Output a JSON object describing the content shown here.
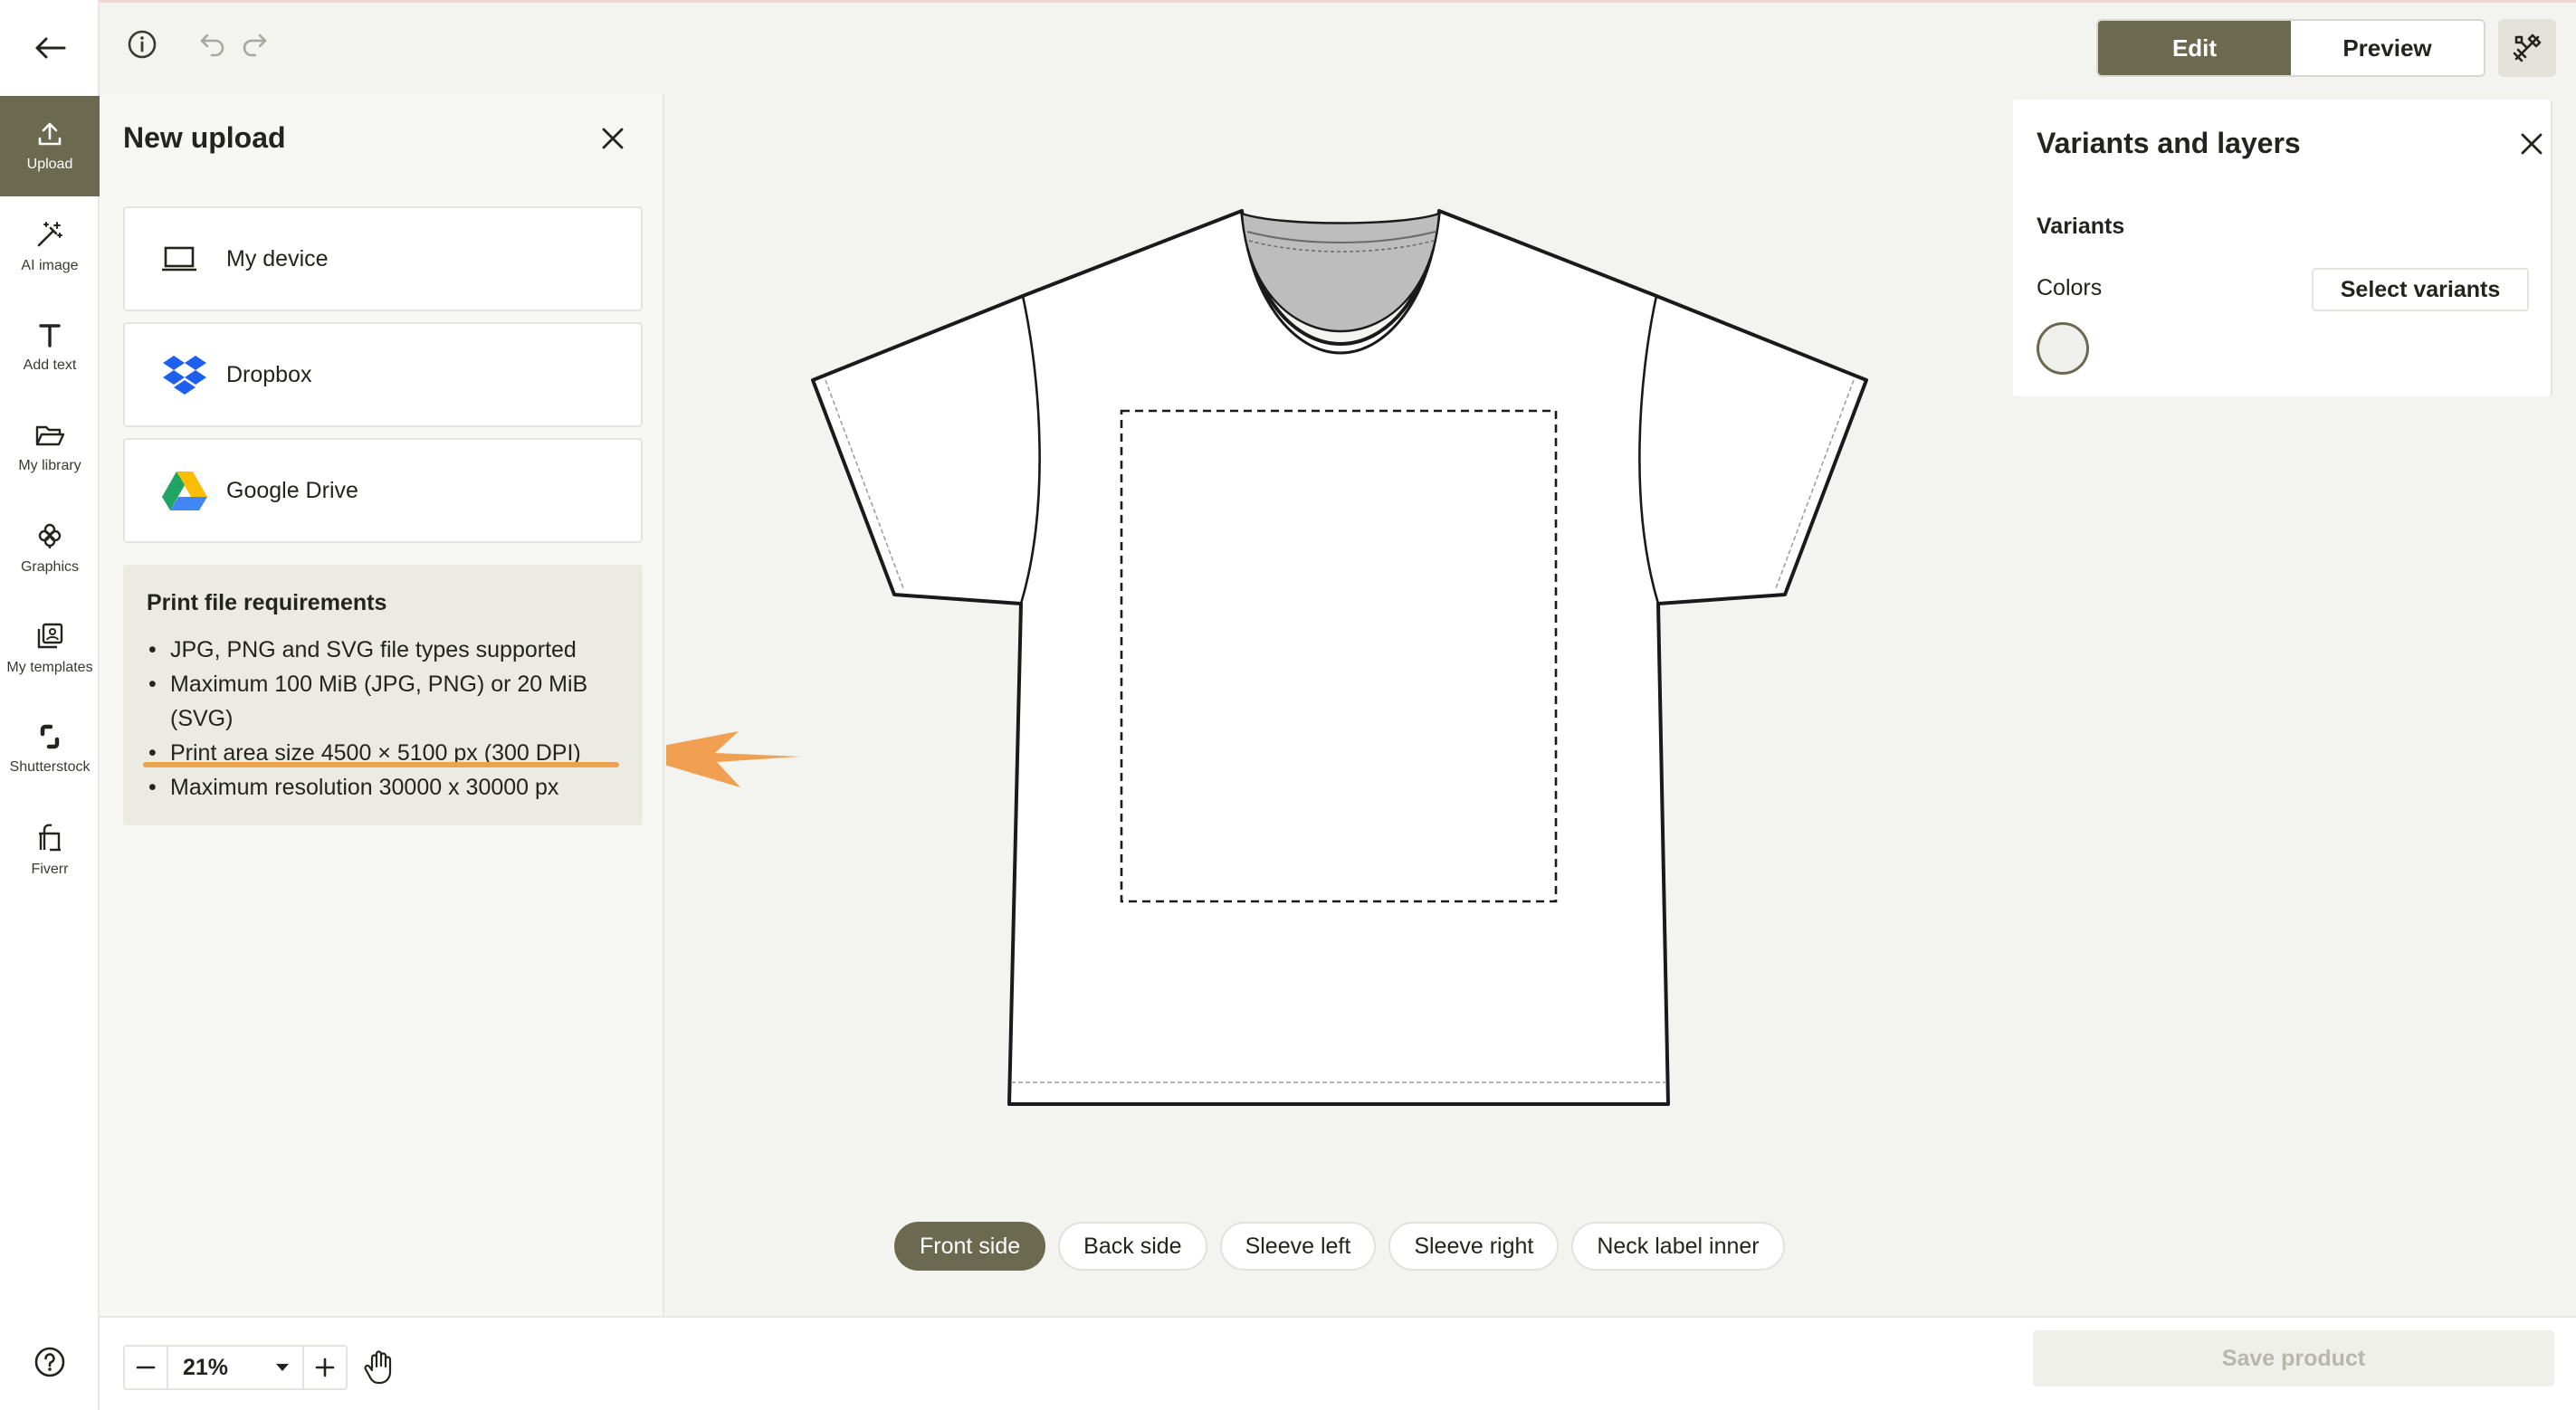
{
  "rail": {
    "back_icon": "arrow-left-icon",
    "items": [
      {
        "label": "Upload",
        "icon": "upload-icon",
        "active": true
      },
      {
        "label": "AI image",
        "icon": "magic-wand-icon"
      },
      {
        "label": "Add text",
        "icon": "text-icon"
      },
      {
        "label": "My library",
        "icon": "folder-icon"
      },
      {
        "label": "Graphics",
        "icon": "flower-icon"
      },
      {
        "label": "My templates",
        "icon": "templates-icon"
      },
      {
        "label": "Shutterstock",
        "icon": "shutterstock-icon"
      },
      {
        "label": "Fiverr",
        "icon": "fiverr-icon"
      }
    ],
    "help_icon": "help-icon"
  },
  "topbar": {
    "info_icon": "info-icon",
    "undo_icon": "undo-icon",
    "redo_icon": "redo-icon",
    "mode": {
      "edit": "Edit",
      "preview": "Preview",
      "active": "Edit"
    },
    "tools_icon": "tools-icon"
  },
  "upload_panel": {
    "title": "New upload",
    "sources": [
      {
        "label": "My device",
        "icon": "laptop-icon"
      },
      {
        "label": "Dropbox",
        "icon": "dropbox-icon"
      },
      {
        "label": "Google Drive",
        "icon": "google-drive-icon"
      }
    ],
    "requirements": {
      "title": "Print file requirements",
      "items": [
        "JPG, PNG and SVG file types supported",
        "Maximum 100 MiB (JPG, PNG) or 20 MiB (SVG)",
        "Print area size 4500 × 5100 px (300 DPI)",
        "Maximum resolution 30000 x 30000 px"
      ],
      "highlighted_index": 2
    }
  },
  "variants_panel": {
    "title": "Variants and layers",
    "section": "Variants",
    "colors_label": "Colors",
    "select_button": "Select variants",
    "swatch_color": "#efefec"
  },
  "side_tabs": {
    "items": [
      "Front side",
      "Back side",
      "Sleeve left",
      "Sleeve right",
      "Neck label inner"
    ],
    "active": "Front side"
  },
  "bottom_bar": {
    "zoom": "21%",
    "save_label": "Save product"
  },
  "colors": {
    "accent": "#6b6950",
    "annotation_arrow": "#f0a050"
  }
}
